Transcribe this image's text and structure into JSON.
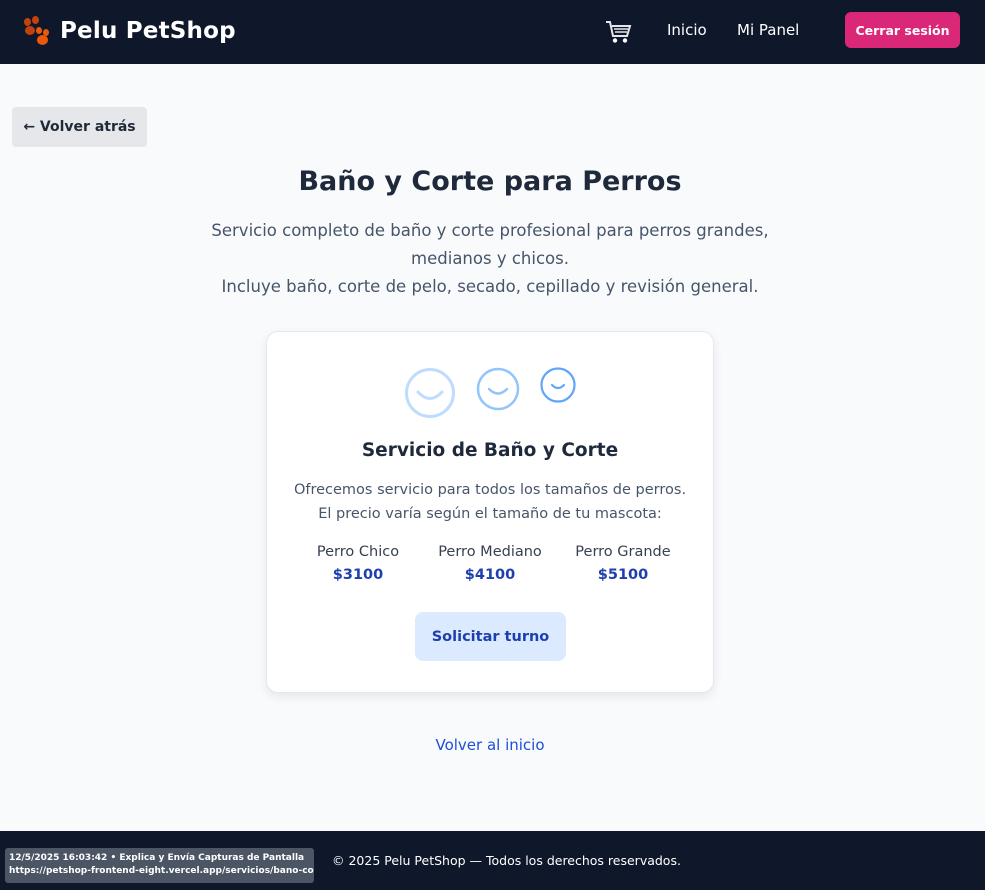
{
  "navbar": {
    "brand": "Pelu PetShop",
    "links": [
      "Inicio",
      "Mi Panel"
    ],
    "logout_label": "Cerrar sesión",
    "icons": [
      "paw-icon",
      "cart-icon"
    ]
  },
  "main": {
    "back_label": "← Volver atrás",
    "title": "Baño y Corte para Perros",
    "description_line1": "Servicio completo de baño y corte profesional para perros grandes, medianos y chicos.",
    "description_line2": "Incluye baño, corte de pelo, secado, cepillado y revisión general.",
    "card": {
      "title": "Servicio de Baño y Corte",
      "text_line1": "Ofrecemos servicio para todos los tamaños de perros.",
      "text_line2": "El precio varía según el tamaño de tu mascota:",
      "sizes": [
        {
          "name": "Perro Chico",
          "price": "$3100"
        },
        {
          "name": "Perro Mediano",
          "price": "$4100"
        },
        {
          "name": "Perro Grande",
          "price": "$5100"
        }
      ],
      "request_label": "Solicitar turno",
      "icons": [
        "smiley-large-icon",
        "smiley-medium-icon",
        "smiley-small-icon"
      ]
    },
    "home_link": "Volver al inicio"
  },
  "footer": {
    "copyright": "© 2025 Pelu PetShop — Todos los derechos reservados.",
    "stamp_line1": "12/5/2025 16:03:42 • Explica y Envía Capturas de Pantalla",
    "stamp_line2": "https://petshop-frontend-eight.vercel.app/servicios/bano-corte"
  },
  "colors": {
    "navbar_bg": "#0f172a",
    "accent": "#db2777",
    "price": "#1e40af",
    "request_bg": "#dbeafe"
  }
}
